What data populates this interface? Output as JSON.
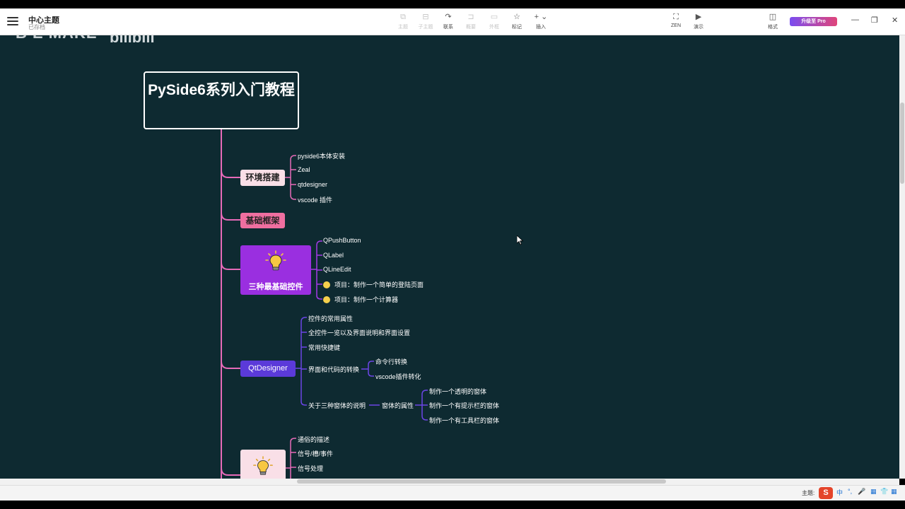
{
  "app": {
    "doc_title": "中心主题",
    "doc_subtitle": "已存档",
    "upgrade_label": "升级至 Pro"
  },
  "toolbar": {
    "tools": [
      {
        "id": "topic",
        "label": "主题",
        "icon": "topic-icon",
        "enabled": false
      },
      {
        "id": "subtopic",
        "label": "子主题",
        "icon": "subtopic-icon",
        "enabled": false
      },
      {
        "id": "relation",
        "label": "联系",
        "icon": "relation-icon",
        "enabled": true
      },
      {
        "id": "summary",
        "label": "概要",
        "icon": "summary-icon",
        "enabled": false
      },
      {
        "id": "boundary",
        "label": "外框",
        "icon": "boundary-icon",
        "enabled": false
      },
      {
        "id": "marker",
        "label": "标记",
        "icon": "star-icon",
        "enabled": true
      },
      {
        "id": "insert",
        "label": "插入",
        "icon": "plus-icon",
        "enabled": true
      }
    ],
    "zen_label": "ZEN",
    "present_label": "演示",
    "format_label": "格式"
  },
  "canvas": {
    "watermark_left": "B E MAKE",
    "watermark_right": "bilibili",
    "background": "#0e2a31"
  },
  "mindmap": {
    "root": "PySide6系列入门教程",
    "branches": {
      "env": {
        "label": "环境搭建",
        "children": [
          "pyside6本体安装",
          "Zeal",
          "qtdesigner",
          "vscode 插件"
        ]
      },
      "frame": {
        "label": "基础框架"
      },
      "controls": {
        "label": "三种最基础控件",
        "children": [
          "QPushButton",
          "QLabel",
          "QLineEdit",
          "项目：制作一个简单的登陆页面",
          "项目：制作一个计算器"
        ]
      },
      "qtdesigner": {
        "label": "QtDesigner",
        "children": [
          "控件的常用属性",
          "全控件一览以及界面说明和界面设置",
          "常用快捷键",
          "界面和代码的转换",
          "关于三种窗体的说明"
        ],
        "convert_children": [
          "命令行转换",
          "vscode插件转化"
        ],
        "window_attr": "窗体的属性",
        "window_children": [
          "制作一个透明的窗体",
          "制作一个有提示栏的窗体",
          "制作一个有工具栏的窗体"
        ]
      },
      "signals": {
        "children": [
          "通俗的描述",
          "信号/槽/事件",
          "信号处理"
        ]
      }
    }
  },
  "statusbar": {
    "theme_label": "主题:",
    "ime_items": [
      "中",
      "°,",
      "🎤",
      "▦",
      "👕",
      "▦"
    ]
  },
  "colors": {
    "line": "#e66ab8",
    "qtd_line": "#6b45e6",
    "ctrl_line": "#a33ae6"
  }
}
